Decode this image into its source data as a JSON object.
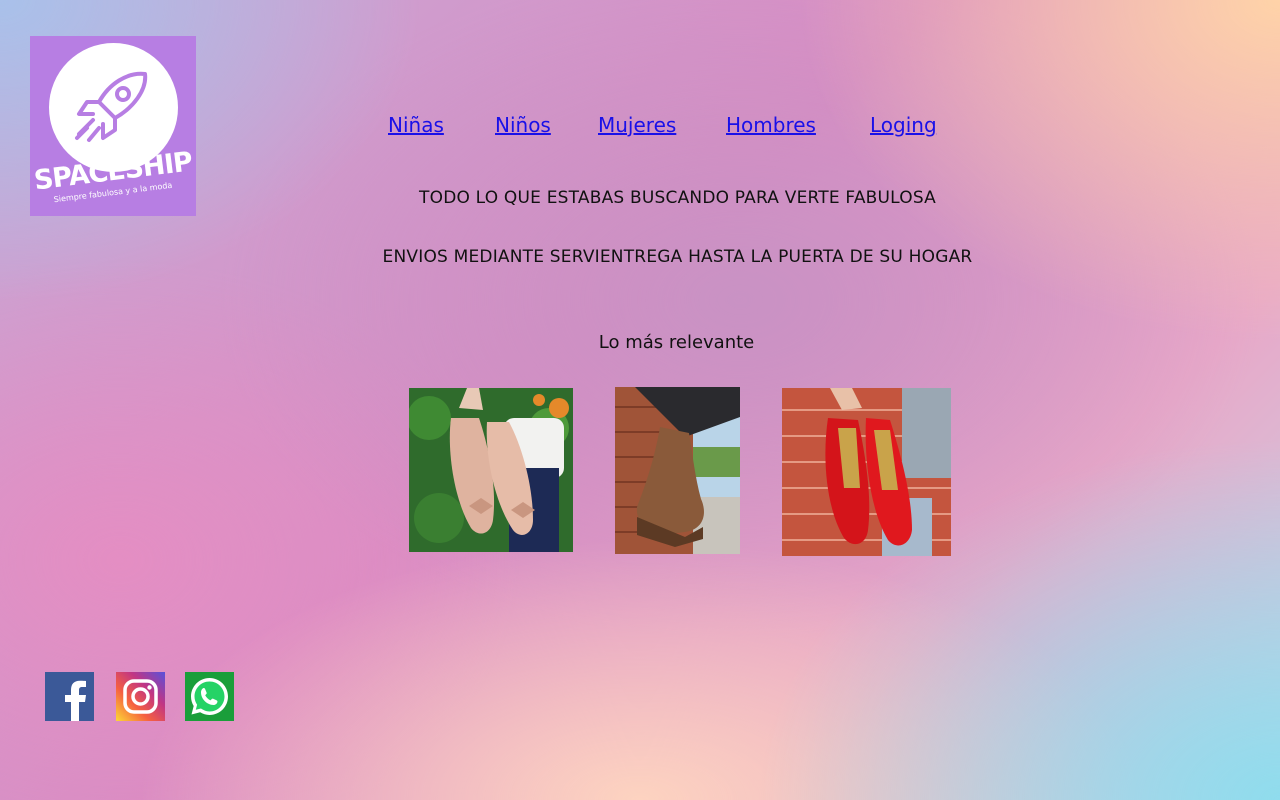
{
  "brand": {
    "name": "SPACESHIP",
    "tagline": "Siempre fabulosa y a la moda",
    "accent_color": "#b77ee3",
    "logo_icon": "rocket-icon"
  },
  "nav": {
    "items": [
      {
        "label": "Niñas"
      },
      {
        "label": "Niños"
      },
      {
        "label": "Mujeres"
      },
      {
        "label": "Hombres"
      },
      {
        "label": "Loging"
      }
    ],
    "link_color": "#1a10e8"
  },
  "banner": {
    "line1": "TODO LO QUE ESTABAS BUSCANDO PARA VERTE FABULOSA",
    "line2": "ENVIOS MEDIANTE SERVIENTREGA HASTA LA PUERTA DE SU HOGAR"
  },
  "featured": {
    "title": "Lo más relevante",
    "products": [
      {
        "image": "nude-ballet-flats-with-bow"
      },
      {
        "image": "brown-lace-up-boot"
      },
      {
        "image": "red-patent-flats"
      }
    ]
  },
  "social": [
    {
      "icon": "facebook-icon",
      "color": "#3b5998"
    },
    {
      "icon": "instagram-icon",
      "color": "#c13584"
    },
    {
      "icon": "whatsapp-icon",
      "color": "#25d366"
    }
  ]
}
